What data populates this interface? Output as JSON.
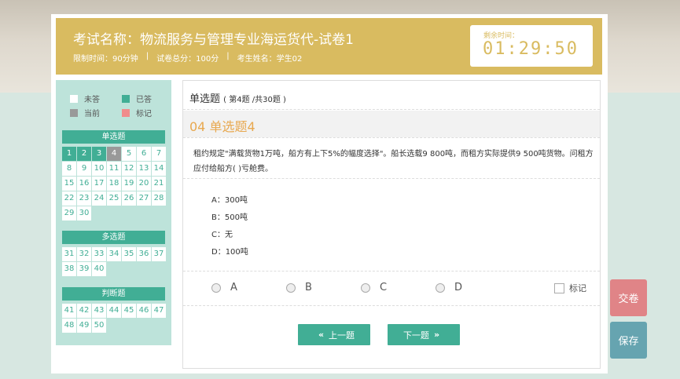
{
  "header": {
    "exam_title": "考试名称：物流服务与管理专业海运货代-试卷1",
    "time_limit": "限制时间：90分钟",
    "total_score": "试卷总分：100分",
    "student": "考生姓名：学生02",
    "separator": "|",
    "timer_label": "剩余时间：",
    "timer_value": "01:29:50",
    "accent_color": "#d9bb60"
  },
  "legend": {
    "unanswered": "未答",
    "answered": "已答",
    "current": "当前",
    "marked": "标记"
  },
  "sections": [
    {
      "title": "单选题",
      "questions": [
        "1",
        "2",
        "3",
        "4",
        "5",
        "6",
        "7",
        "8",
        "9",
        "10",
        "11",
        "12",
        "13",
        "14",
        "15",
        "16",
        "17",
        "18",
        "19",
        "20",
        "21",
        "22",
        "23",
        "24",
        "25",
        "26",
        "27",
        "28",
        "29",
        "30"
      ],
      "answered": [
        1,
        2,
        3
      ],
      "current": 4
    },
    {
      "title": "多选题",
      "questions": [
        "31",
        "32",
        "33",
        "34",
        "35",
        "36",
        "37",
        "38",
        "39",
        "40"
      ]
    },
    {
      "title": "判断题",
      "questions": [
        "41",
        "42",
        "43",
        "44",
        "45",
        "46",
        "47",
        "48",
        "49",
        "50"
      ]
    }
  ],
  "question": {
    "type": "单选题",
    "progress": "( 第4题 /共30题 )",
    "title": "04  单选题4",
    "text": "租约规定\"满载货物1万吨，船方有上下5%的幅度选择\"。船长选载9 800吨，而租方实际提供9 500吨货物。问租方应付给船方( )亏舱费。",
    "options": [
      "A：300吨",
      "B：500吨",
      "C：无",
      "D：100吨"
    ],
    "answer_choices": [
      "A",
      "B",
      "C",
      "D"
    ],
    "mark_label": "标记"
  },
  "nav": {
    "prev": "上一题",
    "next": "下一题"
  },
  "actions": {
    "submit": "交卷",
    "save": "保存"
  },
  "colors": {
    "primary": "#41ae95",
    "title_orange": "#e8a84f",
    "submit": "#e08487",
    "save": "#66a4b0"
  }
}
